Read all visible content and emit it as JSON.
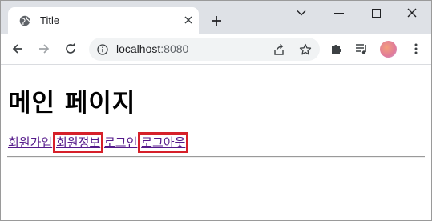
{
  "browser": {
    "tab_title": "Title",
    "url_host": "localhost",
    "url_port": ":8080"
  },
  "page": {
    "heading": "메인 페이지",
    "links": [
      "회원가입",
      "회원정보",
      "로그인",
      "로그아웃"
    ]
  },
  "annotation": {
    "highlight_color": "#d6202a"
  }
}
